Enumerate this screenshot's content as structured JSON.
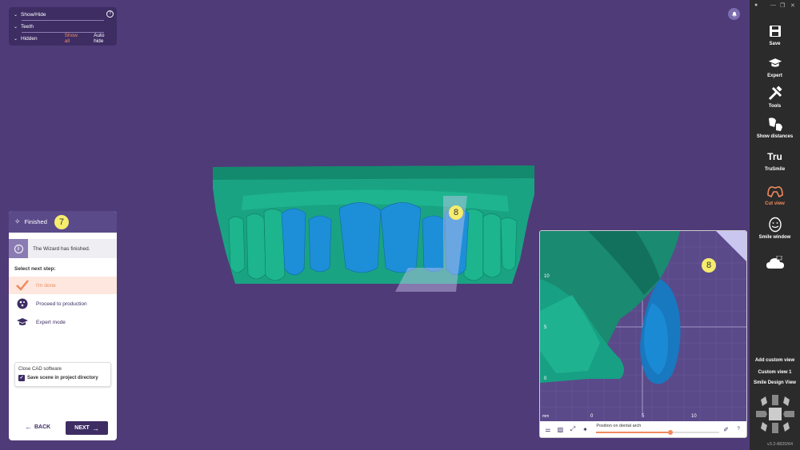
{
  "show_hide": {
    "title": "Show/Hide",
    "teeth_label": "Teeth",
    "hidden_label": "Hidden",
    "show_all_label": "Show all",
    "auto_hide_label": "Auto hide"
  },
  "badges": {
    "wizard": "7",
    "model_cut": "8",
    "cut_view": "8"
  },
  "wizard": {
    "title": "Finished",
    "info_text": "The Wizard has finished.",
    "select_label": "Select next step:",
    "options": [
      {
        "label": "I'm done",
        "icon": "checkmark-icon",
        "active": true
      },
      {
        "label": "Proceed to production",
        "icon": "production-icon",
        "active": false
      },
      {
        "label": "Expert mode",
        "icon": "graduation-cap-icon",
        "active": false
      }
    ],
    "close_title": "Close CAD software",
    "save_scene_label": "Save scene in project directory",
    "save_scene_checked": true,
    "back_label": "BACK",
    "next_label": "NEXT"
  },
  "cut_view": {
    "y_ticks": [
      "10",
      "5",
      "0"
    ],
    "x_ticks": [
      "0",
      "5",
      "10"
    ],
    "unit": "mm",
    "slider_label": "Position on dental arch",
    "slider_value": 0.6,
    "help": "?"
  },
  "sidebar": {
    "items": [
      {
        "label": "Save",
        "icon": "save-icon"
      },
      {
        "label": "Expert",
        "icon": "graduation-cap-icon"
      },
      {
        "label": "Tools",
        "icon": "tools-icon"
      },
      {
        "label": "Show distances",
        "icon": "distances-icon"
      },
      {
        "label": "TruSmile",
        "icon": "trusmile-icon",
        "icon_text": "Tru"
      },
      {
        "label": "Cut view",
        "icon": "cut-view-icon",
        "active": true
      },
      {
        "label": "Smile window",
        "icon": "smile-window-icon"
      },
      {
        "label": "",
        "icon": "cloud-icon"
      }
    ],
    "links": [
      "Add custom view",
      "Custom view 1",
      "Smile Design View"
    ],
    "version": "v3.2-8820/64"
  },
  "colors": {
    "background": "#4f3b78",
    "accent": "#f08a5d",
    "panel_dark": "#3d2d63",
    "gingiva": "#1fb08a",
    "tooth": "#1c8ed6"
  }
}
